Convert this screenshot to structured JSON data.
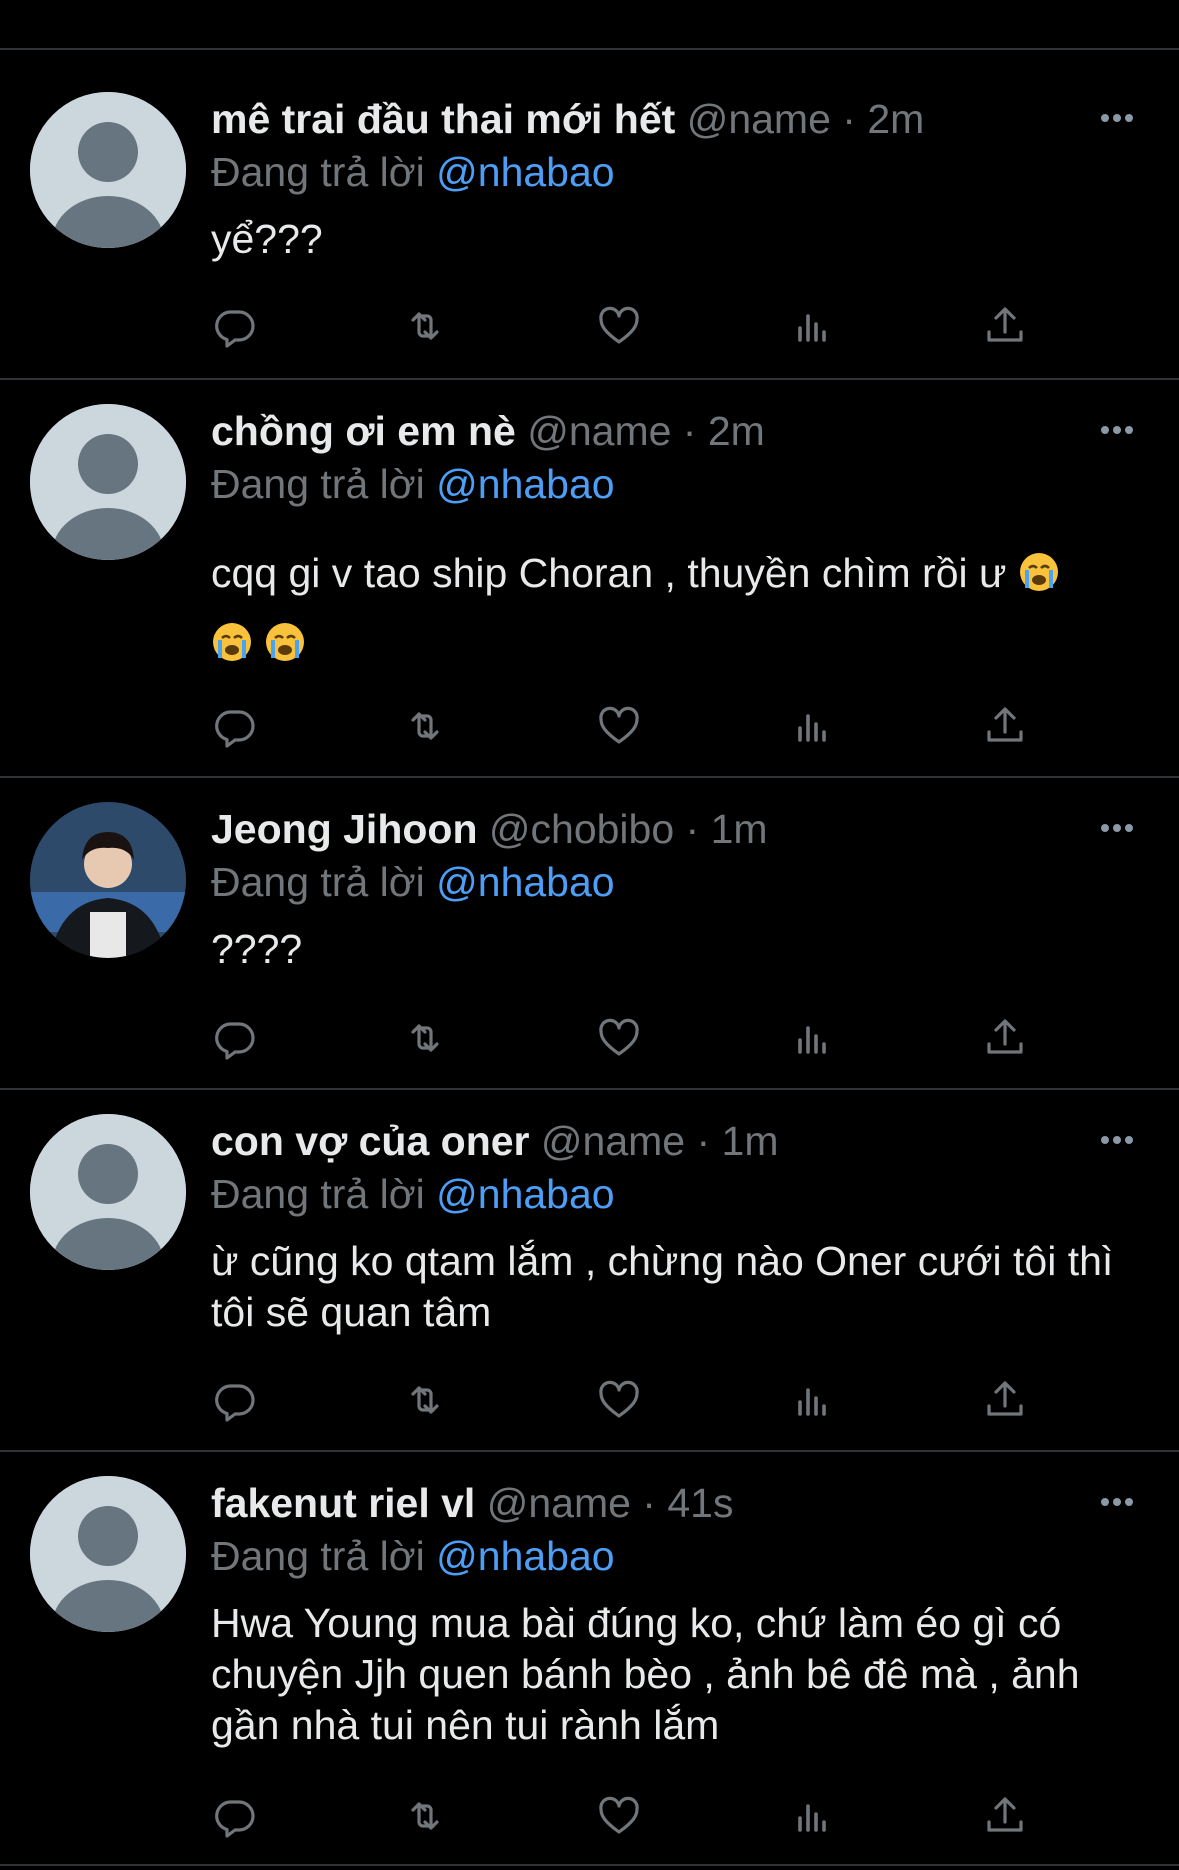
{
  "tweets": [
    {
      "display_name": "mê trai đầu thai mới hết",
      "handle_time": "@name · 2m",
      "reply_prefix": "Đang trả lời",
      "reply_to": "@nhabao",
      "text": "yể???",
      "avatar": "default-avatar"
    },
    {
      "display_name": "chồng ơi em nè",
      "handle_time": "@name · 2m",
      "reply_prefix": "Đang trả lời",
      "reply_to": "@nhabao",
      "text": "cqq gi v tao ship Choran , thuyền chìm rồi ư",
      "emoji": "loudly-crying-face",
      "avatar": "default-avatar"
    },
    {
      "display_name": "Jeong Jihoon",
      "handle_time": "@chobibo · 1m",
      "reply_prefix": "Đang trả lời",
      "reply_to": "@nhabao",
      "text": "????",
      "avatar": "photo-avatar"
    },
    {
      "display_name": "con vợ của oner",
      "handle_time": "@name · 1m",
      "reply_prefix": "Đang trả lời",
      "reply_to": "@nhabao",
      "text": "ừ cũng ko qtam lắm , chừng nào Oner cưới tôi thì tôi sẽ quan tâm",
      "avatar": "default-avatar"
    },
    {
      "display_name": "fakenut riel vl",
      "handle_time": "@name · 41s",
      "reply_prefix": "Đang trả lời",
      "reply_to": "@nhabao",
      "text": "Hwa Young mua bài đúng ko, chứ làm éo gì có chuyện Jjh quen bánh bèo , ảnh bê đê mà , ảnh gần nhà tui nên tui rành lắm",
      "avatar": "default-avatar"
    }
  ],
  "actions": [
    "reply-icon",
    "retweet-icon",
    "like-icon",
    "views-icon",
    "share-icon"
  ],
  "colors": {
    "background": "#000000",
    "text": "#e7e9ea",
    "muted": "#71767b",
    "link": "#4d9ef6",
    "divider": "#2f3336"
  }
}
